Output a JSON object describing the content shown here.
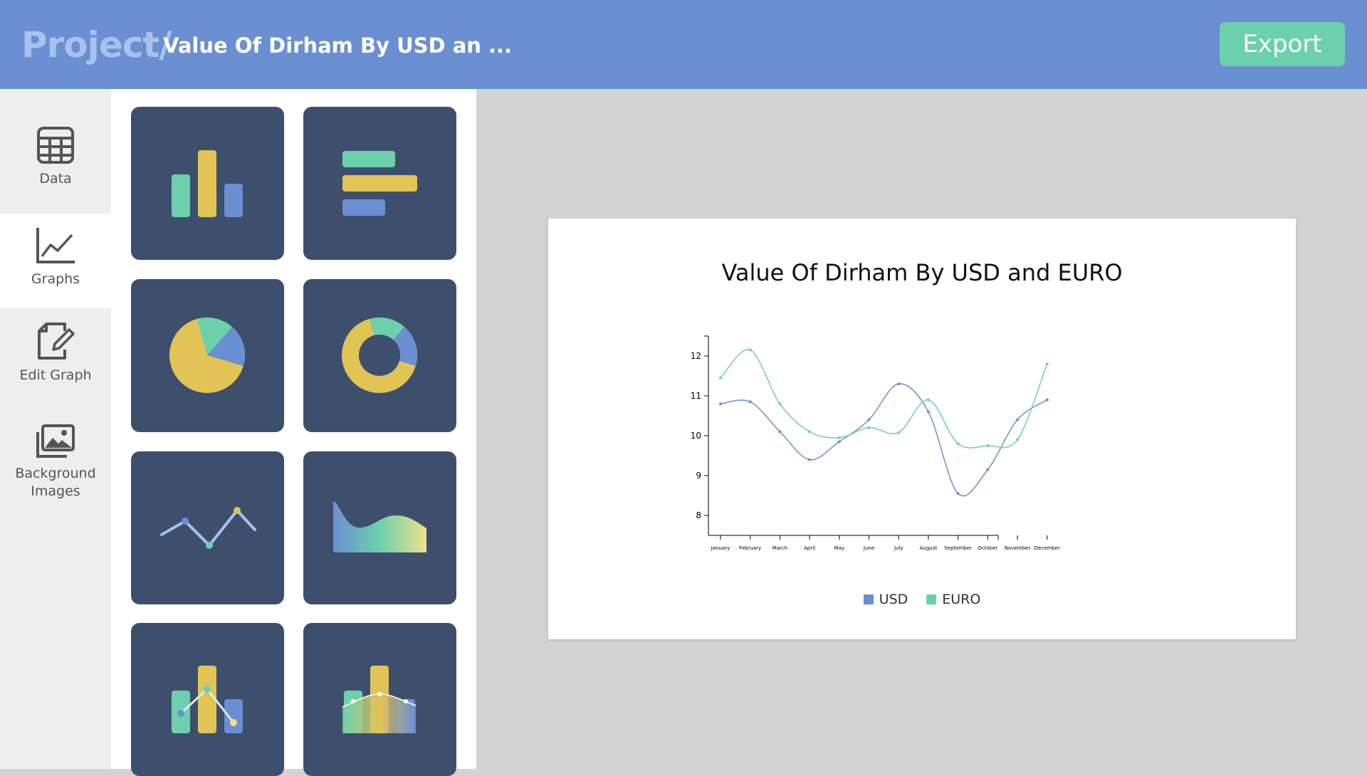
{
  "header": {
    "project_label": "Project/",
    "doc_title": "Value Of Dirham By USD an ...",
    "export_label": "Export"
  },
  "nav": {
    "items": [
      {
        "label": "Data",
        "icon": "table-icon",
        "active": false
      },
      {
        "label": "Graphs",
        "icon": "line-chart-icon",
        "active": true
      },
      {
        "label": "Edit Graph",
        "icon": "edit-document-icon",
        "active": false
      },
      {
        "label": "Background Images",
        "icon": "images-icon",
        "active": false
      }
    ]
  },
  "gallery": {
    "tiles": [
      {
        "icon": "bar-chart-icon"
      },
      {
        "icon": "horizontal-bar-chart-icon"
      },
      {
        "icon": "pie-chart-icon"
      },
      {
        "icon": "donut-chart-icon"
      },
      {
        "icon": "line-chart-icon"
      },
      {
        "icon": "area-chart-icon"
      },
      {
        "icon": "bar-line-combo-chart-icon"
      },
      {
        "icon": "bar-area-combo-chart-icon"
      }
    ]
  },
  "colors": {
    "header": "#6a8fd2",
    "accent_green": "#6dd0ad",
    "accent_yellow": "#e2c356",
    "accent_blue": "#6a8fd2",
    "tile_bg": "#3d4f6c",
    "usd": "#6a8fd2",
    "euro": "#6dd0ad"
  },
  "chart_data": {
    "type": "line",
    "title": "Value Of Dirham By USD and EURO",
    "categories": [
      "January",
      "February",
      "March",
      "April",
      "May",
      "June",
      "July",
      "August",
      "September",
      "October",
      "November",
      "December"
    ],
    "series": [
      {
        "name": "USD",
        "color": "#6a8fd2",
        "values": [
          10.8,
          10.85,
          10.1,
          9.4,
          9.85,
          10.4,
          11.3,
          10.6,
          8.55,
          9.15,
          10.4,
          10.9
        ]
      },
      {
        "name": "EURO",
        "color": "#6dd0ad",
        "values": [
          11.45,
          12.15,
          10.8,
          10.1,
          9.95,
          10.2,
          10.08,
          10.9,
          9.8,
          9.75,
          9.9,
          11.8
        ]
      }
    ],
    "ylim": [
      7.5,
      12.5
    ],
    "yticks": [
      8,
      9,
      10,
      11,
      12
    ],
    "smooth": true,
    "grid": false,
    "legend": "bottom-center"
  }
}
